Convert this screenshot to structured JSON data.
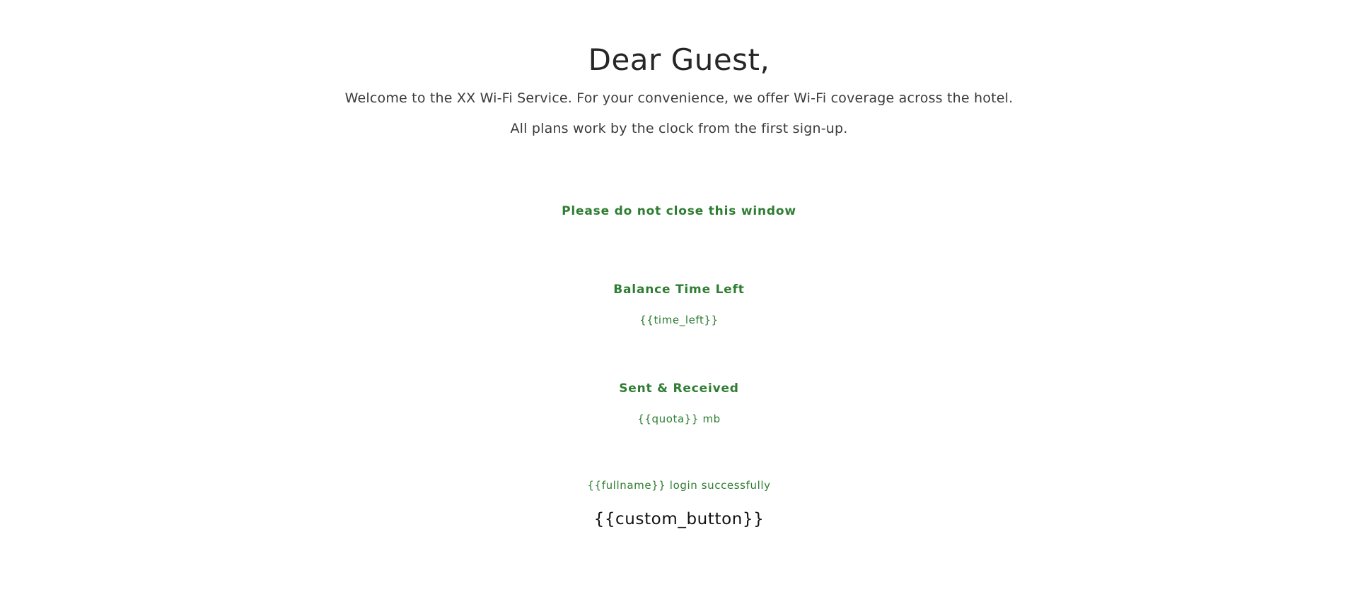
{
  "header": {
    "title": "Dear Guest,"
  },
  "intro": {
    "line1": "Welcome to the XX Wi-Fi Service. For your convenience, we offer Wi-Fi coverage across the hotel.",
    "line2": "All plans work by the clock from the first sign-up."
  },
  "notice": {
    "text": "Please do not close this window"
  },
  "balance": {
    "label": "Balance Time Left",
    "value": "{{time_left}}"
  },
  "usage": {
    "label": "Sent & Received",
    "value": "{{quota}} mb"
  },
  "status": {
    "login_message": "{{fullname}} login successfully"
  },
  "actions": {
    "custom_button_label": "{{custom_button}}"
  },
  "colors": {
    "accent_green": "#2e7d32",
    "heading_text": "#262626",
    "background": "#ffffff"
  }
}
